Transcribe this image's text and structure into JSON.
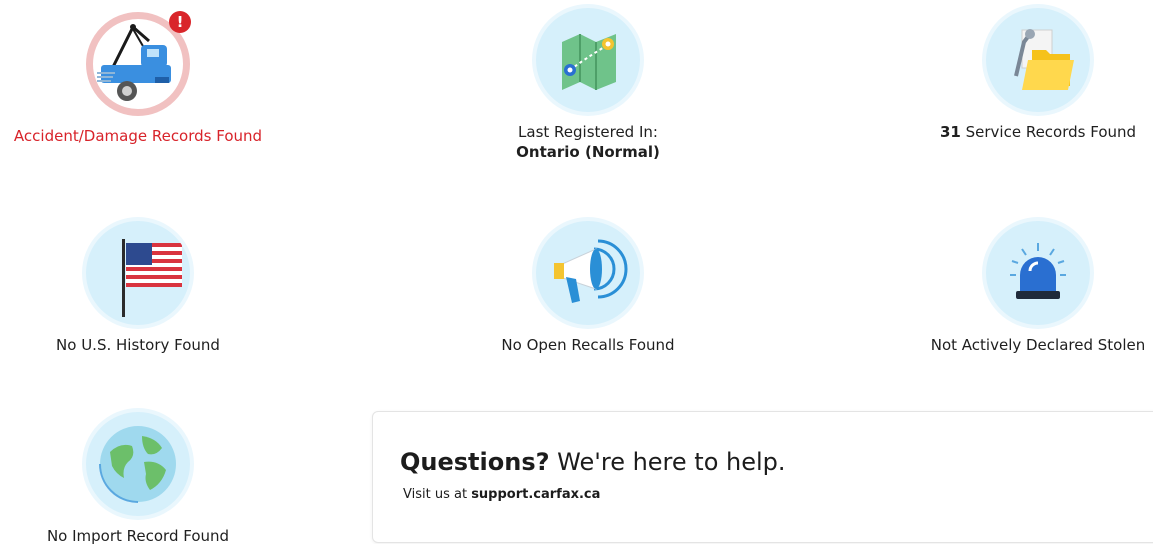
{
  "tiles": [
    {
      "id": "accident",
      "label": "Accident/Damage Records Found",
      "icon": "tow-truck-icon",
      "status": "alert",
      "badge": "!"
    },
    {
      "id": "registration",
      "label_prefix": "Last Registered In:",
      "label_value": "Ontario (Normal)",
      "icon": "map-icon"
    },
    {
      "id": "service",
      "label_count": "31",
      "label_suffix": "Service Records Found",
      "icon": "folder-wrench-icon"
    },
    {
      "id": "us-history",
      "label": "No U.S. History Found",
      "icon": "us-flag-icon"
    },
    {
      "id": "recalls",
      "label": "No Open Recalls Found",
      "icon": "megaphone-icon"
    },
    {
      "id": "stolen",
      "label": "Not Actively Declared Stolen",
      "icon": "siren-icon"
    },
    {
      "id": "import",
      "label": "No Import Record Found",
      "icon": "globe-icon"
    }
  ],
  "help": {
    "heading_bold": "Questions?",
    "heading_rest": " We're here to help.",
    "sub_prefix": "Visit us at ",
    "sub_link": "support.carfax.ca"
  },
  "colors": {
    "alert_red": "#d8232a",
    "icon_bg": "#d6f0fb"
  }
}
